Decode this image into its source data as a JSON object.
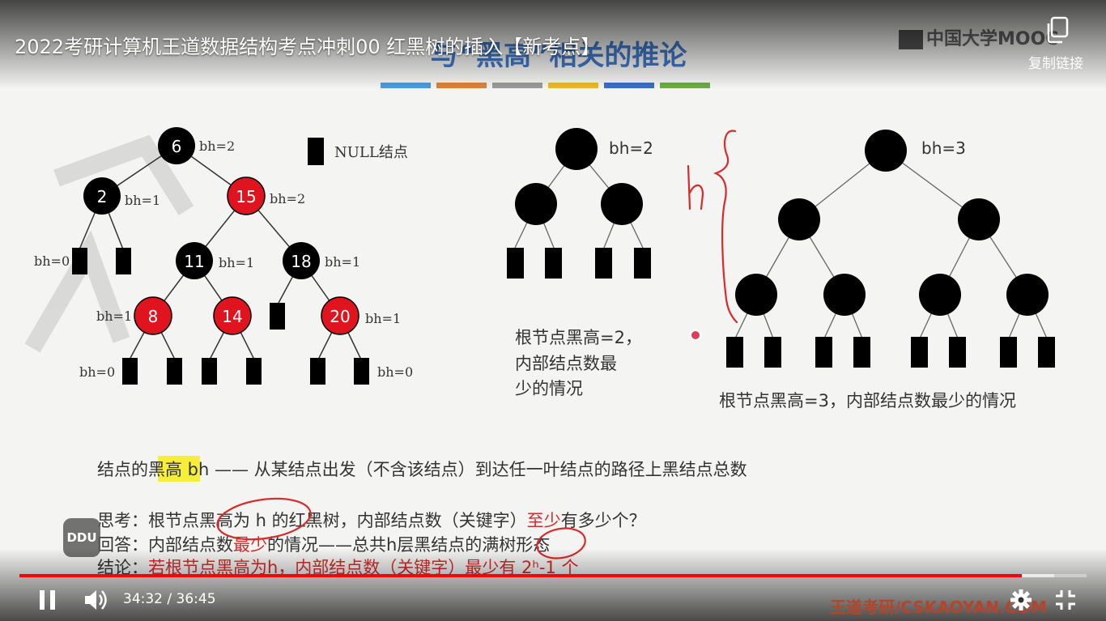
{
  "video": {
    "title": "2022考研计算机王道数据结构考点冲刺00 红黑树的插入【新考点】",
    "copy_link_label": "复制链接",
    "mooc_logo": "中国大学MOOC",
    "ddu_logo": "DDU",
    "watermark": "王道考研/CSKAOYAN.COM"
  },
  "controls": {
    "current_time": "34:32",
    "separator": "/",
    "duration": "36:45",
    "played_fraction": 0.9395,
    "buffered_fraction": 0.97
  },
  "slide": {
    "heading": "与“黑高”相关的推论",
    "null_legend": "NULL结点",
    "tree1": {
      "nodes": [
        {
          "id": "n6",
          "value": "6",
          "color": "black",
          "bh": "bh=2"
        },
        {
          "id": "n2",
          "value": "2",
          "color": "black",
          "bh": "bh=1"
        },
        {
          "id": "n15",
          "value": "15",
          "color": "red",
          "bh": "bh=2"
        },
        {
          "id": "n11",
          "value": "11",
          "color": "black",
          "bh": "bh=1"
        },
        {
          "id": "n18",
          "value": "18",
          "color": "black",
          "bh": "bh=1"
        },
        {
          "id": "n8",
          "value": "8",
          "color": "red",
          "bh": "bh=1"
        },
        {
          "id": "n14",
          "value": "14",
          "color": "red",
          "bh": ""
        },
        {
          "id": "n20",
          "value": "20",
          "color": "red",
          "bh": "bh=1"
        }
      ],
      "leaf_labels": [
        "bh=0",
        "bh=0",
        "bh=0"
      ]
    },
    "tree2": {
      "bh": "bh=2",
      "caption_lines": [
        "根节点黑高=2，",
        "内部结点数最",
        "少的情况"
      ]
    },
    "tree3": {
      "bh": "bh=3",
      "caption": "根节点黑高=3，内部结点数最少的情况",
      "handwritten_h": "h"
    },
    "definition": {
      "prefix": "结点的",
      "highlight": "黑高",
      "rest": " bh —— 从某结点出发（不含该结点）到达任一叶结点的路径上黑结点总数"
    },
    "think": {
      "label": "思考：",
      "text_a": "根节点黑高为 h 的红黑树，内部结点数（关键字）",
      "text_red": "至少",
      "text_b": "有多少个？"
    },
    "answer": {
      "label": "回答：",
      "text_a": "内部结点数",
      "text_red": "最少",
      "text_b": "的情况——总共h层黑结点的满树形态"
    },
    "conclusion": {
      "label": "结论：",
      "text_red": "若根节点黑高为h，内部结点数（关键字）最少有 2ʰ-1 个"
    }
  },
  "colors": {
    "progress_played": "#ff0000",
    "red_node": "#e0141e",
    "black_node": "#000000",
    "highlight": "#f5ef3a",
    "annotation_red": "#d82a2a",
    "heading_blue": "#3f78c8",
    "color_bar": [
      "#4f9ad8",
      "#d8823c",
      "#9a9a9a",
      "#e8b92a",
      "#3b6fc0",
      "#6aac4a"
    ]
  },
  "icons": {
    "copy": "copy-icon",
    "pause": "pause-icon",
    "volume": "volume-icon",
    "settings": "gear-icon",
    "exit_fullscreen": "exit-fullscreen-icon"
  }
}
